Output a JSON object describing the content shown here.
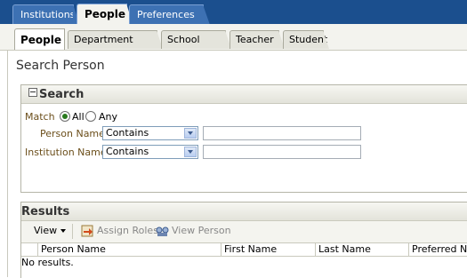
{
  "top_tabs": [
    "Institutions",
    "People",
    "Preferences"
  ],
  "sub_tabs": [
    "People",
    "Department Staff",
    "School Staff",
    "Teacher",
    "Student"
  ],
  "page_title": "Search Person",
  "search_panel": {
    "title": "Search",
    "match_label": "Match",
    "match_options": [
      "All",
      "Any"
    ],
    "match_selected": "All",
    "fields": [
      {
        "label": "Person Name",
        "operator": "Contains",
        "value": ""
      },
      {
        "label": "Institution Name",
        "operator": "Contains",
        "value": ""
      }
    ]
  },
  "results": {
    "title": "Results",
    "toolbar": {
      "view": "View",
      "assign_roles": "Assign Roles",
      "view_person": "View Person"
    },
    "columns": [
      "Person Name",
      "First Name",
      "Last Name",
      "Preferred Nar"
    ],
    "empty_text": "No results."
  }
}
